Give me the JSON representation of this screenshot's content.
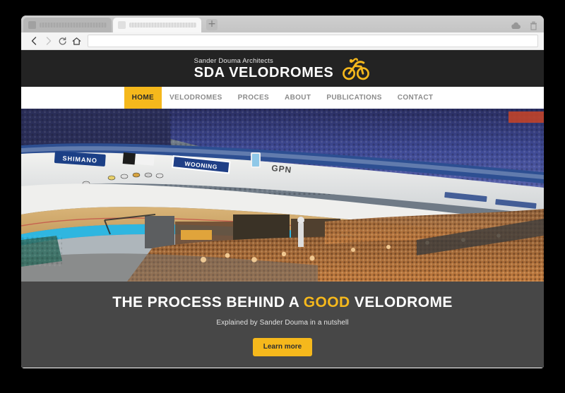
{
  "browser": {
    "tabs": [
      {
        "title": "",
        "active": false
      },
      {
        "title": "",
        "active": true
      }
    ],
    "new_tab_label": "+",
    "toolbar": {
      "back_icon": "back-arrow-icon",
      "forward_icon": "forward-arrow-icon",
      "reload_icon": "reload-icon",
      "home_icon": "home-icon",
      "url_value": "",
      "url_placeholder": ""
    },
    "tabstrip_icons": [
      "cloud-icon",
      "trash-icon"
    ]
  },
  "site": {
    "header": {
      "tagline": "Sander Douma Architects",
      "title": "SDA VELODROMES",
      "logo_icon": "cyclist-logo-icon",
      "background_color": "#232323",
      "accent_color": "#f5b81c"
    },
    "nav": {
      "items": [
        {
          "label": "HOME",
          "active": true
        },
        {
          "label": "VELODROMES",
          "active": false
        },
        {
          "label": "PROCES",
          "active": false
        },
        {
          "label": "ABOUT",
          "active": false
        },
        {
          "label": "PUBLICATIONS",
          "active": false
        },
        {
          "label": "CONTACT",
          "active": false
        }
      ]
    },
    "hero": {
      "alt": "Indoor velodrome with cyclists racing on wooden track and full crowd",
      "banner_ads": [
        "SHIMANO",
        "WOONING",
        "GPN"
      ]
    },
    "caption": {
      "title_part1": "THE PROCESS BEHIND A ",
      "title_highlight": "GOOD",
      "title_part2": " VELODROME",
      "subtitle": "Explained by Sander Douma in a nutshell",
      "button_label": "Learn more",
      "background_color": "#474747"
    }
  }
}
